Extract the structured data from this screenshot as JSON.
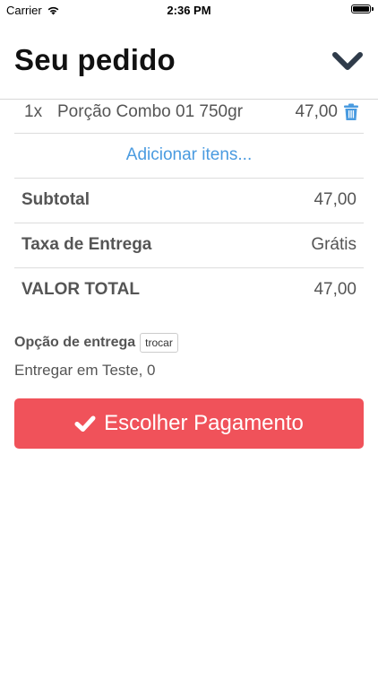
{
  "status_bar": {
    "carrier": "Carrier",
    "time": "2:36 PM",
    "icons": [
      "wifi-icon",
      "battery-icon"
    ]
  },
  "header": {
    "title": "Seu pedido",
    "collapse_icon": "chevron-down-icon"
  },
  "order": {
    "items": [
      {
        "qty": "1x",
        "name": "Porção Combo 01 750gr",
        "price": "47,00",
        "delete_icon": "trash-icon"
      }
    ],
    "add_items_label": "Adicionar itens..."
  },
  "summary": {
    "subtotal_label": "Subtotal",
    "subtotal_value": "47,00",
    "delivery_fee_label": "Taxa de Entrega",
    "delivery_fee_value": "Grátis",
    "total_label": "VALOR TOTAL",
    "total_value": "47,00"
  },
  "delivery": {
    "option_label": "Opção de entrega",
    "change_label": "trocar",
    "address": "Entregar em Teste, 0"
  },
  "payment": {
    "button_label": "Escolher Pagamento",
    "button_icon": "checkmark-icon",
    "button_color": "#f0525a"
  },
  "colors": {
    "accent": "#4a9be0",
    "text": "#555555",
    "title": "#111111"
  }
}
